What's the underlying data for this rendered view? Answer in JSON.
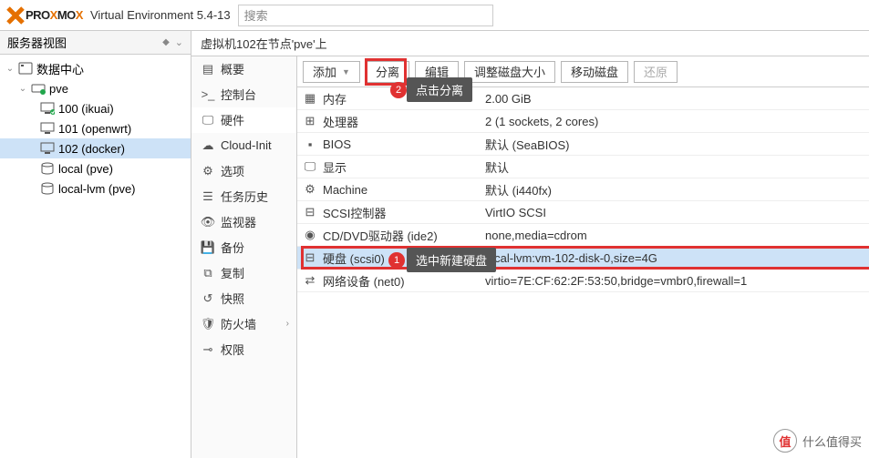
{
  "header": {
    "logo_text": "PROXMOX",
    "version": "Virtual Environment 5.4-13",
    "search_placeholder": "搜索"
  },
  "left": {
    "view_label": "服务器视图",
    "tree": {
      "datacenter": "数据中心",
      "node": "pve",
      "vms": [
        "100 (ikuai)",
        "101 (openwrt)",
        "102 (docker)"
      ],
      "storages": [
        "local (pve)",
        "local-lvm (pve)"
      ]
    }
  },
  "breadcrumb": "虚拟机102在节点'pve'上",
  "subnav": {
    "summary": "概要",
    "console": "控制台",
    "hardware": "硬件",
    "cloudinit": "Cloud-Init",
    "options": "选项",
    "taskhistory": "任务历史",
    "monitor": "监视器",
    "backup": "备份",
    "replication": "复制",
    "snapshot": "快照",
    "firewall": "防火墙",
    "permissions": "权限"
  },
  "toolbar": {
    "add": "添加",
    "detach": "分离",
    "edit": "编辑",
    "resize": "调整磁盘大小",
    "move": "移动磁盘",
    "restore": "还原"
  },
  "hardware": [
    {
      "icon": "memory",
      "key": "内存",
      "val": "2.00 GiB"
    },
    {
      "icon": "cpu",
      "key": "处理器",
      "val": "2 (1 sockets, 2 cores)"
    },
    {
      "icon": "bios",
      "key": "BIOS",
      "val": "默认 (SeaBIOS)"
    },
    {
      "icon": "display",
      "key": "显示",
      "val": "默认"
    },
    {
      "icon": "machine",
      "key": "Machine",
      "val": "默认 (i440fx)"
    },
    {
      "icon": "scsi",
      "key": "SCSI控制器",
      "val": "VirtIO SCSI"
    },
    {
      "icon": "cd",
      "key": "CD/DVD驱动器 (ide2)",
      "val": "none,media=cdrom"
    },
    {
      "icon": "disk",
      "key": "硬盘 (scsi0)",
      "val": "local-lvm:vm-102-disk-0,size=4G"
    },
    {
      "icon": "net",
      "key": "网络设备 (net0)",
      "val": "virtio=7E:CF:62:2F:53:50,bridge=vmbr0,firewall=1"
    }
  ],
  "tooltips": {
    "tip1": "选中新建硬盘",
    "tip2": "点击分离"
  },
  "watermark": "什么值得买"
}
